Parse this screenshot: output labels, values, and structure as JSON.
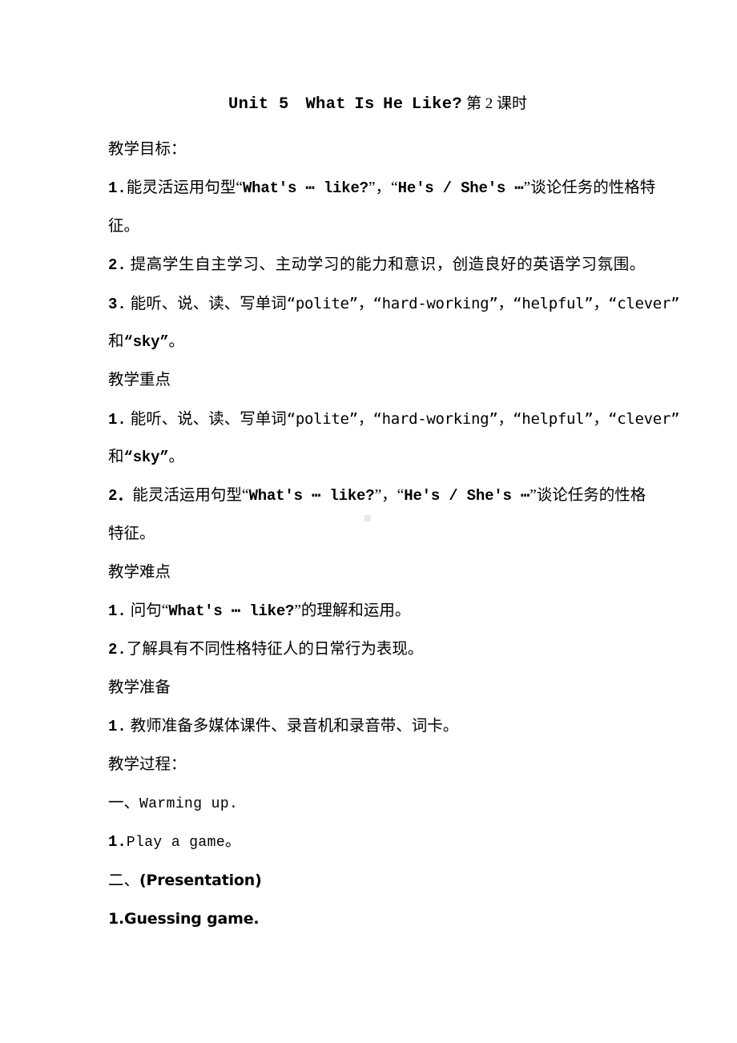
{
  "document": {
    "title_en": "Unit 5 What Is He Like?",
    "title_cn": "第 2 课时",
    "background_color": "#ffffff",
    "text_color": "#000000"
  },
  "sections": {
    "objectives_heading": "教学目标：",
    "objective_1_a": "1.",
    "objective_1_b": "能灵活运用句型",
    "objective_1_quote_open": "“",
    "objective_1_en1": "What's ⋯ like?",
    "objective_1_mid": "”，“",
    "objective_1_en2": "He's / She's ⋯",
    "objective_1_quote_close": "”",
    "objective_1_tail": "谈论任务的性格特",
    "objective_1_wrap": "征。",
    "objective_2_num": "2.",
    "objective_2_text": "提高学生自主学习、主动学习的能力和意识，创造良好的英语学习氛围。",
    "objective_3_num": "3.",
    "objective_3_text": "能听、说、读、写单词",
    "objective_3_words": "“polite”，“hard-working”，“helpful”，“clever”",
    "objective_3_wrap_cn": "和",
    "objective_3_wrap_word": "“sky”",
    "objective_3_wrap_end": "。",
    "keypoints_heading": "教学重点",
    "keypoint_1_num": "1.",
    "keypoint_1_text": "能听、说、读、写单词",
    "keypoint_1_words": "“polite”，“hard-working”，“helpful”，“clever”",
    "keypoint_1_wrap_cn": "和",
    "keypoint_1_wrap_word": "“sky”",
    "keypoint_1_wrap_end": "。",
    "keypoint_2_num": "2．",
    "keypoint_2_text": "能灵活运用句型",
    "keypoint_2_quote_open": "“",
    "keypoint_2_en1": "What's ⋯ like?",
    "keypoint_2_mid": "”，“",
    "keypoint_2_en2": "He's / She's ⋯",
    "keypoint_2_quote_close": "”",
    "keypoint_2_tail": "谈论任务的性格",
    "keypoint_2_wrap": "特征。",
    "difficulties_heading": "教学难点",
    "difficulty_1_num": "1.",
    "difficulty_1_text": "问句",
    "difficulty_1_quote_open": "“",
    "difficulty_1_en": "What's ⋯ like?",
    "difficulty_1_quote_close": "”",
    "difficulty_1_tail": "的理解和运用。",
    "difficulty_2_num": "2.",
    "difficulty_2_text": "了解具有不同性格特征人的日常行为表现。",
    "preparation_heading": "教学准备",
    "preparation_1_num": "1.",
    "preparation_1_text": "教师准备多媒体课件、录音机和录音带、词卡。",
    "process_heading": "教学过程：",
    "step_1_cn": "一、",
    "step_1_en": "Warming up.",
    "step_1_item_num": "1.",
    "step_1_item_en": "Play a game",
    "step_1_item_end": "。",
    "step_2_cn": "二、",
    "step_2_en": "(Presentation)",
    "step_2_item_num": "1.",
    "step_2_item_en": "Guessing game."
  }
}
